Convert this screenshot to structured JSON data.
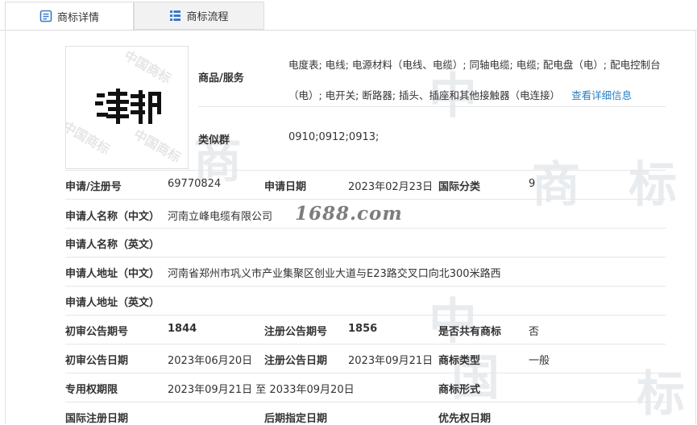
{
  "tabs": [
    {
      "label": "商标详情",
      "icon": "document-icon",
      "active": true
    },
    {
      "label": "商标流程",
      "icon": "list-icon",
      "active": false
    }
  ],
  "logo": {
    "text": "津邦"
  },
  "goods": {
    "label": "商品/服务",
    "text": "电度表; 电线; 电源材料（电线、电缆）; 同轴电缆; 电缆; 配电盘（电）; 配电控制台（电）; 电开关; 断路器; 插头、插座和其他接触器（电连接）",
    "link": "查看详细信息"
  },
  "similar_group": {
    "label": "类似群",
    "value": "0910;0912;0913;"
  },
  "rows": {
    "reg_no_label": "申请/注册号",
    "reg_no": "69770824",
    "apply_date_label": "申请日期",
    "apply_date": "2023年02月23日",
    "intl_class_label": "国际分类",
    "intl_class": "9",
    "applicant_cn_label": "申请人名称（中文）",
    "applicant_cn": "河南立峰电缆有限公司",
    "applicant_en_label": "申请人名称（英文）",
    "applicant_en": "",
    "address_cn_label": "申请人地址（中文）",
    "address_cn": "河南省郑州市巩义市产业集聚区创业大道与E23路交叉口向北300米路西",
    "address_en_label": "申请人地址（英文）",
    "address_en": "",
    "prelim_issue_label": "初审公告期号",
    "prelim_issue": "1844",
    "reg_issue_label": "注册公告期号",
    "reg_issue": "1856",
    "shared_label": "是否共有商标",
    "shared": "否",
    "prelim_date_label": "初审公告日期",
    "prelim_date": "2023年06月20日",
    "reg_date_label": "注册公告日期",
    "reg_date": "2023年09月21日",
    "tm_type_label": "商标类型",
    "tm_type": "一般",
    "exclusive_label": "专用权期限",
    "exclusive": "2023年09月21日 至 2033年09月20日",
    "tm_form_label": "商标形式",
    "tm_form": "",
    "intl_reg_date_label": "国际注册日期",
    "intl_reg_date": "",
    "later_date_label": "后期指定日期",
    "later_date": "",
    "priority_date_label": "优先权日期",
    "priority_date": ""
  },
  "site_watermark": "1688.com",
  "watermark": {
    "big1": "中",
    "big2": "国",
    "big3": "商",
    "big4": "标",
    "small": "中国商标"
  },
  "colors": {
    "link": "#2a7fc0",
    "tab_inactive_bg": "#f2f2f2",
    "icon_blue": "#3c78c8",
    "border": "#e6e6e6"
  }
}
